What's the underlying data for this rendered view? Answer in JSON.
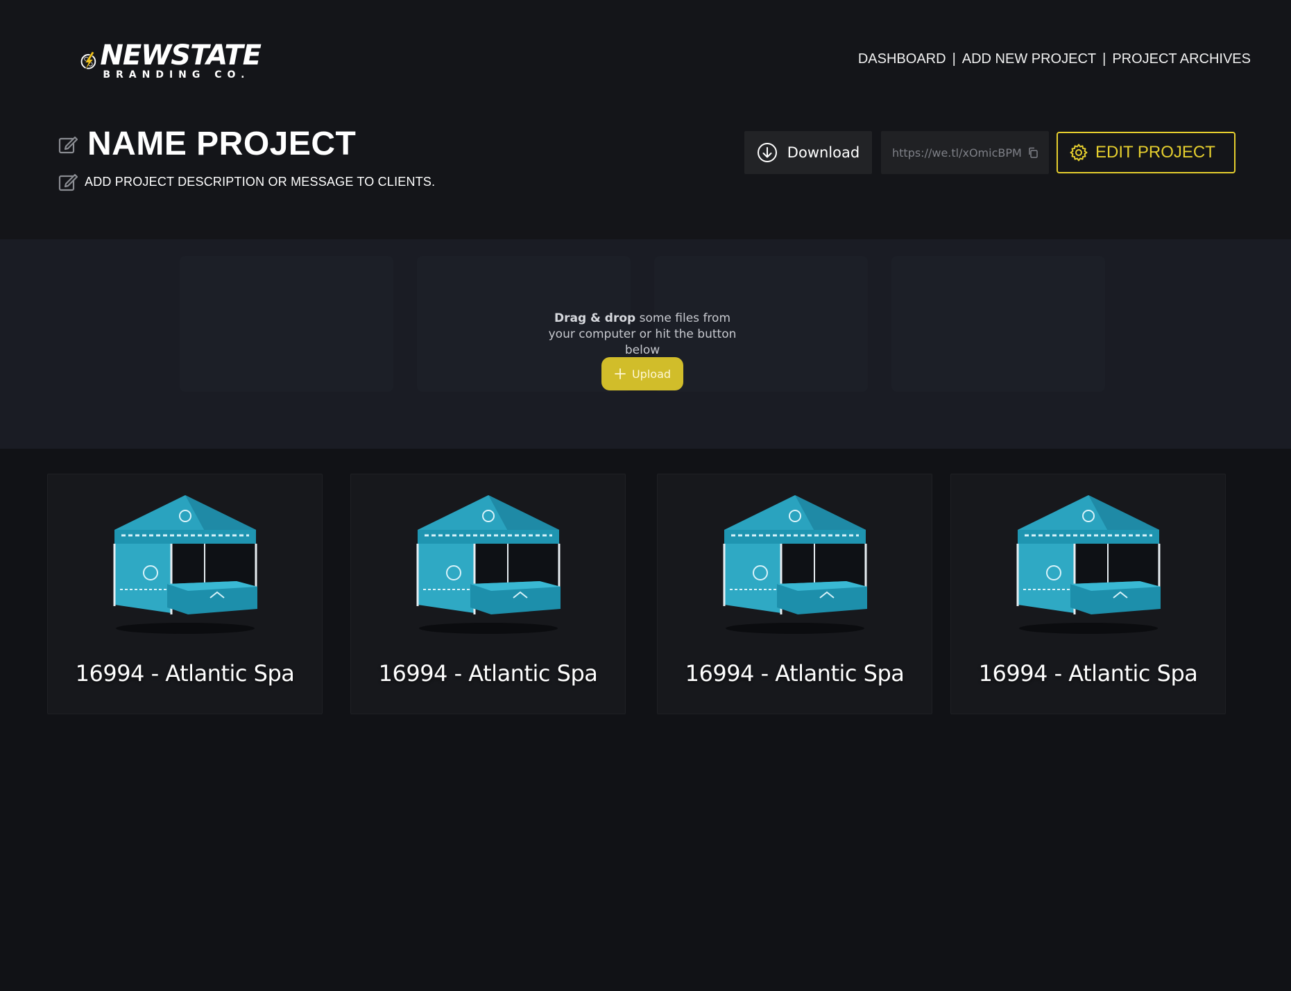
{
  "brand": {
    "name": "NEWSTATE",
    "tagline": "BRANDING CO.",
    "accent_color": "#e6cf2e"
  },
  "nav": {
    "items": [
      {
        "label": "DASHBOARD"
      },
      {
        "label": "ADD NEW PROJECT"
      },
      {
        "label": "PROJECT ARCHIVES"
      }
    ],
    "separator": "|"
  },
  "project": {
    "title": "NAME PROJECT",
    "description": "ADD PROJECT DESCRIPTION OR MESSAGE TO CLIENTS.",
    "edit_icon": "pencil-square-icon"
  },
  "actions": {
    "download_label": "Download",
    "download_icon": "download-circle-icon",
    "share_link": "https://we.tl/xOmicBPM",
    "copy_icon": "copy-icon",
    "edit_label": "EDIT PROJECT",
    "edit_icon": "gear-icon"
  },
  "dropzone": {
    "text_bold": "Drag & drop",
    "text_rest": " some files from your computer or hit the button below",
    "upload_label": "Upload",
    "upload_icon": "plus-icon"
  },
  "cards": [
    {
      "label": "16994 - Atlantic Spa",
      "thumb_icon": "tent-image"
    },
    {
      "label": "16994 - Atlantic Spa",
      "thumb_icon": "tent-image"
    },
    {
      "label": "16994 - Atlantic Spa",
      "thumb_icon": "tent-image"
    },
    {
      "label": "16994 - Atlantic Spa",
      "thumb_icon": "tent-image"
    }
  ]
}
